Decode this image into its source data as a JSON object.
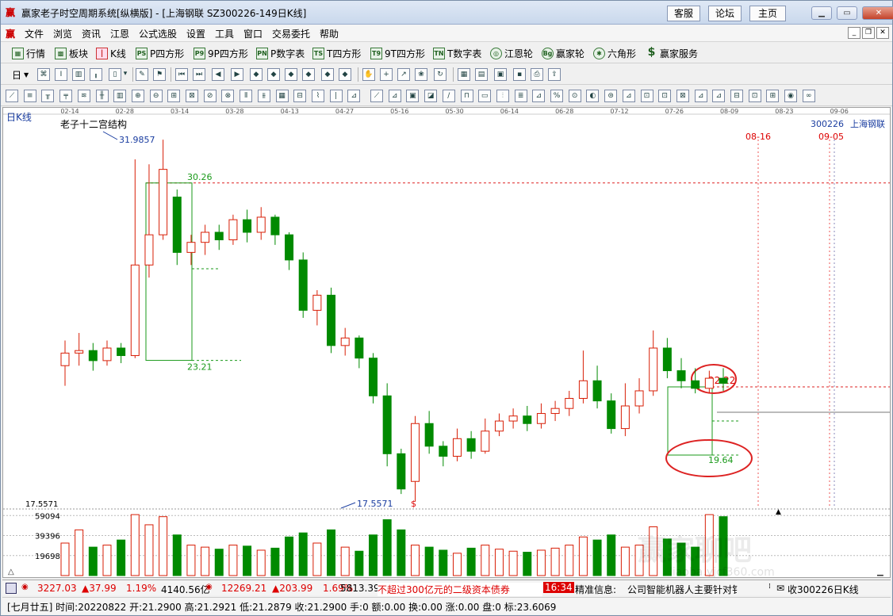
{
  "window": {
    "title": "赢家老子时空周期系统[纵横版] - [上海钢联  SZ300226-149日K线]",
    "logo": "赢",
    "links": [
      "客服",
      "论坛",
      "主页"
    ]
  },
  "menu": {
    "logo": "赢",
    "items": [
      "文件",
      "浏览",
      "资讯",
      "江恩",
      "公式选股",
      "设置",
      "工具",
      "窗口",
      "交易委托",
      "帮助"
    ]
  },
  "toolbar1": {
    "items": [
      {
        "label": "行情",
        "icon": "quote-grid-icon"
      },
      {
        "label": "板块",
        "icon": "sector-icon"
      },
      {
        "label": "K线",
        "icon": "kline-icon"
      },
      {
        "label": "P四方形",
        "icon": "P-square-icon",
        "tag": "PS"
      },
      {
        "label": "9P四方形",
        "icon": "9P-square-icon",
        "tag": "P9"
      },
      {
        "label": "P数字表",
        "icon": "P-number-table-icon",
        "tag": "PN"
      },
      {
        "label": "T四方形",
        "icon": "T-square-icon",
        "tag": "TS"
      },
      {
        "label": "9T四方形",
        "icon": "9T-square-icon",
        "tag": "T9"
      },
      {
        "label": "T数字表",
        "icon": "T-number-table-icon",
        "tag": "TN"
      },
      {
        "label": "江恩轮",
        "icon": "gann-wheel-icon",
        "tag": "◎"
      },
      {
        "label": "赢家轮",
        "icon": "winner-wheel-icon",
        "tag": "Bg"
      },
      {
        "label": "六角形",
        "icon": "hexagon-icon",
        "tag": "✱"
      },
      {
        "label": "赢家服务",
        "icon": "dollar-icon",
        "tag": "$"
      }
    ]
  },
  "toolbar2": {
    "period": "日"
  },
  "chart": {
    "period_label": "日K线",
    "indicator_label": "老子十二宫结构",
    "stock_code": "300226",
    "stock_name": "上海钢联",
    "date_ticks": [
      "02-14",
      "02-28",
      "03-14",
      "03-28",
      "04-13",
      "04-27",
      "05-16",
      "05-30",
      "06-14",
      "06-28",
      "07-12",
      "07-26",
      "08-09",
      "08-23",
      "09-06"
    ],
    "marker_dates": {
      "left": "08-16",
      "right": "09-05"
    },
    "annotations": {
      "high": "31.9857",
      "level1": "30.26",
      "level2": "23.21",
      "low": "17.5571",
      "low_axis": "17.5571",
      "box_high": "22.22",
      "box_low": "19.64",
      "dollar": "$"
    },
    "volume_ticks": [
      "59094",
      "39396",
      "19698"
    ],
    "watermark": "赢家聊吧",
    "watermark_url": "liaoba.yjcf360.com",
    "up_color": "#d81e06",
    "down_color": "#008a00"
  },
  "chart_data": {
    "type": "candlestick",
    "title": "上海钢联 300226 日K线",
    "ylim": [
      17.5571,
      31.9857
    ],
    "candles": [
      [
        23.0,
        23.5,
        22.2,
        24.0
      ],
      [
        23.5,
        23.6,
        23.0,
        24.3
      ],
      [
        23.6,
        23.2,
        22.8,
        23.9
      ],
      [
        23.2,
        23.7,
        23.0,
        24.0
      ],
      [
        23.7,
        23.4,
        23.1,
        23.9
      ],
      [
        23.4,
        27.0,
        23.3,
        31.2
      ],
      [
        27.0,
        28.2,
        26.5,
        31.0
      ],
      [
        28.2,
        30.8,
        28.0,
        31.98
      ],
      [
        29.7,
        27.5,
        27.0,
        30.0
      ],
      [
        27.5,
        27.9,
        27.0,
        28.2
      ],
      [
        27.9,
        28.3,
        27.4,
        28.6
      ],
      [
        28.3,
        28.0,
        27.6,
        28.6
      ],
      [
        28.0,
        28.8,
        27.8,
        29.0
      ],
      [
        28.8,
        28.3,
        27.9,
        29.2
      ],
      [
        28.3,
        28.9,
        28.0,
        29.3
      ],
      [
        28.9,
        28.2,
        27.8,
        29.0
      ],
      [
        28.2,
        27.2,
        26.8,
        28.3
      ],
      [
        27.2,
        25.2,
        24.9,
        27.5
      ],
      [
        25.2,
        25.8,
        24.6,
        26.0
      ],
      [
        25.8,
        23.8,
        23.5,
        26.1
      ],
      [
        23.8,
        24.1,
        23.4,
        24.5
      ],
      [
        24.1,
        23.3,
        22.9,
        24.2
      ],
      [
        23.3,
        21.8,
        21.5,
        23.5
      ],
      [
        21.8,
        19.5,
        19.0,
        22.3
      ],
      [
        19.5,
        18.1,
        17.9,
        19.7
      ],
      [
        18.4,
        20.7,
        17.6,
        21.0
      ],
      [
        20.7,
        19.8,
        19.5,
        21.2
      ],
      [
        19.8,
        19.4,
        19.0,
        20.0
      ],
      [
        19.4,
        20.1,
        19.2,
        20.5
      ],
      [
        20.1,
        19.6,
        19.3,
        20.4
      ],
      [
        19.6,
        20.4,
        19.5,
        20.9
      ],
      [
        20.4,
        20.8,
        20.2,
        21.1
      ],
      [
        20.8,
        21.0,
        20.5,
        21.3
      ],
      [
        21.0,
        20.7,
        20.4,
        21.4
      ],
      [
        20.7,
        21.1,
        20.5,
        21.5
      ],
      [
        21.1,
        21.3,
        20.8,
        21.6
      ],
      [
        21.3,
        21.7,
        21.0,
        22.0
      ],
      [
        21.7,
        22.4,
        21.5,
        23.6
      ],
      [
        22.4,
        21.6,
        21.3,
        23.0
      ],
      [
        21.6,
        20.5,
        20.3,
        21.9
      ],
      [
        20.5,
        21.4,
        20.2,
        22.3
      ],
      [
        21.4,
        22.0,
        21.1,
        22.5
      ],
      [
        22.0,
        23.7,
        21.8,
        24.4
      ],
      [
        23.7,
        22.8,
        22.5,
        24.1
      ],
      [
        22.8,
        22.4,
        22.1,
        23.3
      ],
      [
        22.4,
        22.1,
        21.9,
        22.9
      ],
      [
        22.1,
        22.5,
        21.9,
        22.8
      ],
      [
        22.5,
        22.3,
        22.0,
        22.9
      ]
    ],
    "volume": [
      32000,
      45000,
      28000,
      30000,
      35000,
      60000,
      50000,
      58000,
      40000,
      30000,
      28000,
      26000,
      30000,
      29000,
      25000,
      27000,
      38000,
      42000,
      32000,
      45000,
      28000,
      24000,
      40000,
      55000,
      45000,
      30000,
      28000,
      25000,
      22000,
      27000,
      30000,
      26000,
      24000,
      23000,
      25000,
      27000,
      30000,
      38000,
      35000,
      40000,
      28000,
      30000,
      48000,
      36000,
      32000,
      28000,
      60000,
      58000
    ]
  },
  "status1": {
    "sh_index": "3227.03",
    "sh_change": "▲37.99",
    "sh_pct": "1.19%",
    "sh_amount": "4140.56亿",
    "sz_index": "12269.21",
    "sz_change": "▲203.99",
    "sz_pct": "1.69%",
    "sz_amount": "5813.39",
    "ticker": "不超过300亿元的二级资本债券",
    "time": "16:34",
    "news_label": "精准信息:",
    "news_text": "公司智能机器人主要针对钅",
    "right_text": "收300226日K线"
  },
  "status2": {
    "text": "[七月廿五]  时间:20220822 开:21.2900 高:21.2921 低:21.2879 收:21.2900 手:0 额:0.00 换:0.00 涨:0.00 盘:0 标:23.6069"
  }
}
